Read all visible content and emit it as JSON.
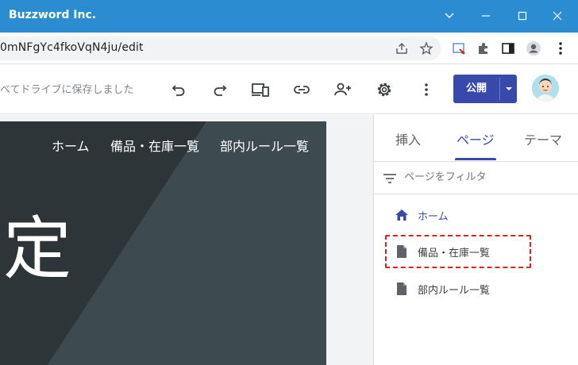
{
  "window": {
    "title": "Buzzword Inc."
  },
  "address_bar": {
    "url": "0mNFgYc4fkoVqN4ju/edit"
  },
  "toolbar": {
    "save_status": "べてドライブに保存しました",
    "publish_label": "公開"
  },
  "site_preview": {
    "nav_items": [
      "ホーム",
      "備品・在庫一覧",
      "部内ルール一覧"
    ],
    "heading_fragment": "定"
  },
  "panel": {
    "tabs": [
      "挿入",
      "ページ",
      "テーマ"
    ],
    "active_tab": "ページ",
    "filter_placeholder": "ページをフィルタ",
    "pages": [
      {
        "label": "ホーム",
        "icon": "home-icon"
      },
      {
        "label": "備品・在庫一覧",
        "icon": "page-icon"
      },
      {
        "label": "部内ルール一覧",
        "icon": "page-icon"
      }
    ]
  },
  "colors": {
    "titlebar": "#2b8cd1",
    "accent": "#3949ab",
    "highlight": "#e0201c"
  }
}
